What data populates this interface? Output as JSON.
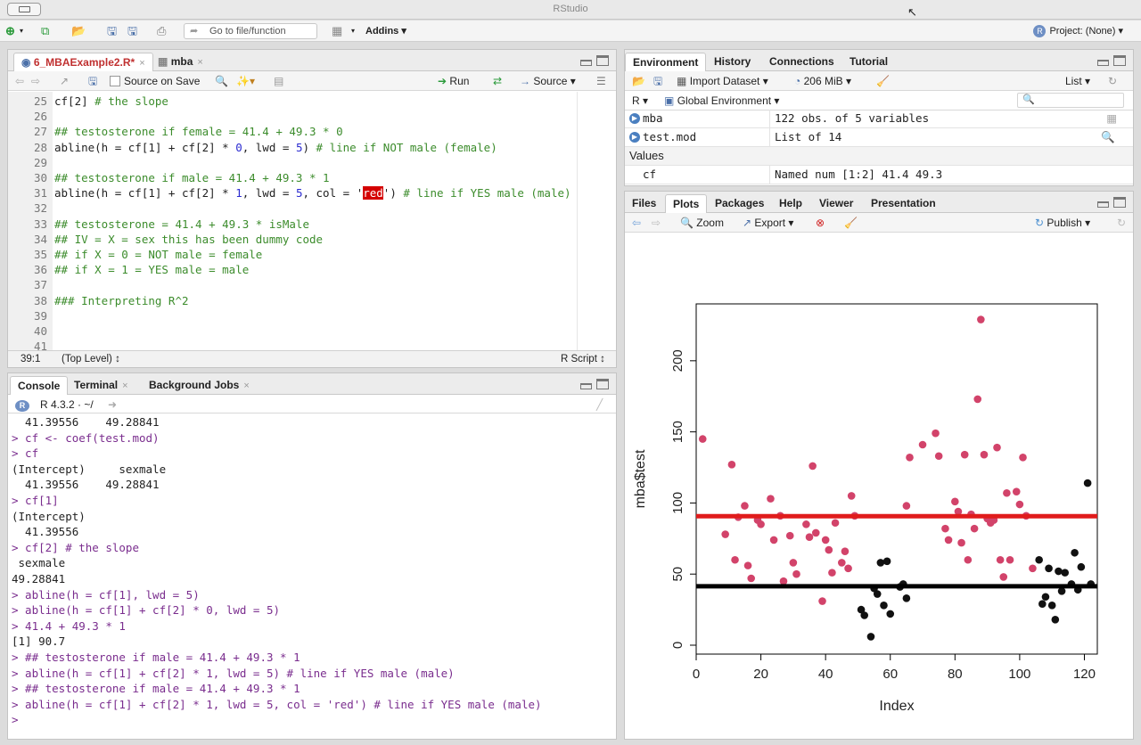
{
  "app": {
    "title": "RStudio"
  },
  "toolbar": {
    "goto_placeholder": "Go to file/function",
    "addins_label": "Addins",
    "project_label": "Project: (None)"
  },
  "editor": {
    "tabs": [
      {
        "label": "6_MBAExample2.R*"
      },
      {
        "label": "mba"
      }
    ],
    "source_on_save": "Source on Save",
    "run_label": "Run",
    "source_label": "Source",
    "lines": [
      {
        "n": "25",
        "text": "cf[2] # the slope"
      },
      {
        "n": "26",
        "text": ""
      },
      {
        "n": "27",
        "text": "## testosterone if female = 41.4 + 49.3 * 0"
      },
      {
        "n": "28",
        "text": "abline(h = cf[1] + cf[2] * 0, lwd = 5) # line if NOT male (female)"
      },
      {
        "n": "29",
        "text": ""
      },
      {
        "n": "30",
        "text": "## testosterone if male = 41.4 + 49.3 * 1"
      },
      {
        "n": "31",
        "text": "abline(h = cf[1] + cf[2] * 1, lwd = 5, col = 'red') # line if YES male (male)"
      },
      {
        "n": "32",
        "text": ""
      },
      {
        "n": "33",
        "text": "## testosterone = 41.4 + 49.3 * isMale"
      },
      {
        "n": "34",
        "text": "## IV = X = sex this has been dummy code"
      },
      {
        "n": "35",
        "text": "## if X = 0 = NOT male = female"
      },
      {
        "n": "36",
        "text": "## if X = 1 = YES male = male"
      },
      {
        "n": "37",
        "text": ""
      },
      {
        "n": "38",
        "text": "### Interpreting R^2"
      },
      {
        "n": "39",
        "text": ""
      },
      {
        "n": "40",
        "text": ""
      },
      {
        "n": "41",
        "text": ""
      }
    ],
    "status_pos": "39:1",
    "status_scope": "(Top Level)",
    "status_type": "R Script"
  },
  "console": {
    "tabs": [
      {
        "label": "Console"
      },
      {
        "label": "Terminal"
      },
      {
        "label": "Background Jobs"
      }
    ],
    "r_version": "R 4.3.2 · ~/",
    "lines": [
      {
        "kind": "out",
        "text": "  41.39556    49.28841"
      },
      {
        "kind": "in",
        "text": "> cf <- coef(test.mod)"
      },
      {
        "kind": "in",
        "text": "> cf"
      },
      {
        "kind": "out",
        "text": "(Intercept)     sexmale"
      },
      {
        "kind": "out",
        "text": "  41.39556    49.28841"
      },
      {
        "kind": "in",
        "text": "> cf[1]"
      },
      {
        "kind": "out",
        "text": "(Intercept)"
      },
      {
        "kind": "out",
        "text": "  41.39556"
      },
      {
        "kind": "in",
        "text": "> cf[2] # the slope"
      },
      {
        "kind": "out",
        "text": " sexmale"
      },
      {
        "kind": "out",
        "text": "49.28841"
      },
      {
        "kind": "in",
        "text": "> abline(h = cf[1], lwd = 5)"
      },
      {
        "kind": "in",
        "text": "> abline(h = cf[1] + cf[2] * 0, lwd = 5)"
      },
      {
        "kind": "in",
        "text": "> 41.4 + 49.3 * 1"
      },
      {
        "kind": "out",
        "text": "[1] 90.7"
      },
      {
        "kind": "in",
        "text": "> ## testosterone if male = 41.4 + 49.3 * 1"
      },
      {
        "kind": "in",
        "text": "> abline(h = cf[1] + cf[2] * 1, lwd = 5) # line if YES male (male)"
      },
      {
        "kind": "in",
        "text": "> ## testosterone if male = 41.4 + 49.3 * 1"
      },
      {
        "kind": "in",
        "text": "> abline(h = cf[1] + cf[2] * 1, lwd = 5, col = 'red') # line if YES male (male)"
      },
      {
        "kind": "in",
        "text": "> "
      }
    ]
  },
  "environment": {
    "tabs": [
      {
        "label": "Environment"
      },
      {
        "label": "History"
      },
      {
        "label": "Connections"
      },
      {
        "label": "Tutorial"
      }
    ],
    "import_label": "Import Dataset",
    "memory": "206 MiB",
    "list_label": "List",
    "lang": "R",
    "scope": "Global Environment",
    "data_rows": [
      {
        "name": "mba",
        "value": "122 obs. of 5 variables"
      },
      {
        "name": "test.mod",
        "value": "List of  14"
      }
    ],
    "values_header": "Values",
    "value_rows": [
      {
        "name": "cf",
        "value": "Named num [1:2] 41.4 49.3"
      }
    ]
  },
  "files": {
    "tabs": [
      {
        "label": "Files"
      },
      {
        "label": "Plots"
      },
      {
        "label": "Packages"
      },
      {
        "label": "Help"
      },
      {
        "label": "Viewer"
      },
      {
        "label": "Presentation"
      }
    ],
    "zoom_label": "Zoom",
    "export_label": "Export",
    "publish_label": "Publish"
  },
  "chart_data": {
    "type": "scatter",
    "xlabel": "Index",
    "ylabel": "mba$test",
    "xlim": [
      0,
      124
    ],
    "ylim": [
      0,
      240
    ],
    "xticks": [
      0,
      20,
      40,
      60,
      80,
      100,
      120
    ],
    "yticks": [
      0,
      50,
      100,
      150,
      200
    ],
    "hlines": [
      {
        "y": 41.4,
        "color": "#000000"
      },
      {
        "y": 90.7,
        "color": "#e01c1c"
      }
    ],
    "series": [
      {
        "color": "#d2436a",
        "points": [
          [
            2,
            145
          ],
          [
            9,
            78
          ],
          [
            11,
            127
          ],
          [
            12,
            60
          ],
          [
            13,
            90
          ],
          [
            15,
            98
          ],
          [
            16,
            56
          ],
          [
            17,
            47
          ],
          [
            19,
            88
          ],
          [
            20,
            85
          ],
          [
            23,
            103
          ],
          [
            24,
            74
          ],
          [
            26,
            91
          ],
          [
            27,
            45
          ],
          [
            29,
            77
          ],
          [
            30,
            58
          ],
          [
            31,
            50
          ],
          [
            34,
            85
          ],
          [
            35,
            76
          ],
          [
            36,
            126
          ],
          [
            37,
            79
          ],
          [
            39,
            31
          ],
          [
            40,
            74
          ],
          [
            41,
            67
          ],
          [
            42,
            51
          ],
          [
            43,
            86
          ],
          [
            45,
            58
          ],
          [
            46,
            66
          ],
          [
            47,
            54
          ],
          [
            48,
            105
          ],
          [
            49,
            91
          ],
          [
            65,
            98
          ],
          [
            66,
            132
          ],
          [
            70,
            141
          ],
          [
            74,
            149
          ],
          [
            75,
            133
          ],
          [
            77,
            82
          ],
          [
            78,
            74
          ],
          [
            80,
            101
          ],
          [
            81,
            94
          ],
          [
            82,
            72
          ],
          [
            83,
            134
          ],
          [
            84,
            60
          ],
          [
            85,
            92
          ],
          [
            86,
            82
          ],
          [
            87,
            173
          ],
          [
            88,
            229
          ],
          [
            89,
            134
          ],
          [
            90,
            89
          ],
          [
            91,
            86
          ],
          [
            92,
            88
          ],
          [
            93,
            139
          ],
          [
            94,
            60
          ],
          [
            95,
            48
          ],
          [
            96,
            107
          ],
          [
            97,
            60
          ],
          [
            99,
            108
          ],
          [
            100,
            99
          ],
          [
            101,
            132
          ],
          [
            102,
            91
          ],
          [
            104,
            54
          ]
        ]
      },
      {
        "color": "#111111",
        "points": [
          [
            51,
            25
          ],
          [
            52,
            21
          ],
          [
            54,
            6
          ],
          [
            55,
            40
          ],
          [
            56,
            36
          ],
          [
            57,
            58
          ],
          [
            58,
            28
          ],
          [
            59,
            59
          ],
          [
            60,
            22
          ],
          [
            63,
            41
          ],
          [
            64,
            43
          ],
          [
            65,
            33
          ],
          [
            106,
            60
          ],
          [
            107,
            29
          ],
          [
            108,
            34
          ],
          [
            109,
            54
          ],
          [
            110,
            28
          ],
          [
            111,
            18
          ],
          [
            112,
            52
          ],
          [
            113,
            38
          ],
          [
            114,
            51
          ],
          [
            116,
            43
          ],
          [
            117,
            65
          ],
          [
            118,
            39
          ],
          [
            119,
            55
          ],
          [
            121,
            114
          ],
          [
            122,
            43
          ]
        ]
      }
    ]
  }
}
